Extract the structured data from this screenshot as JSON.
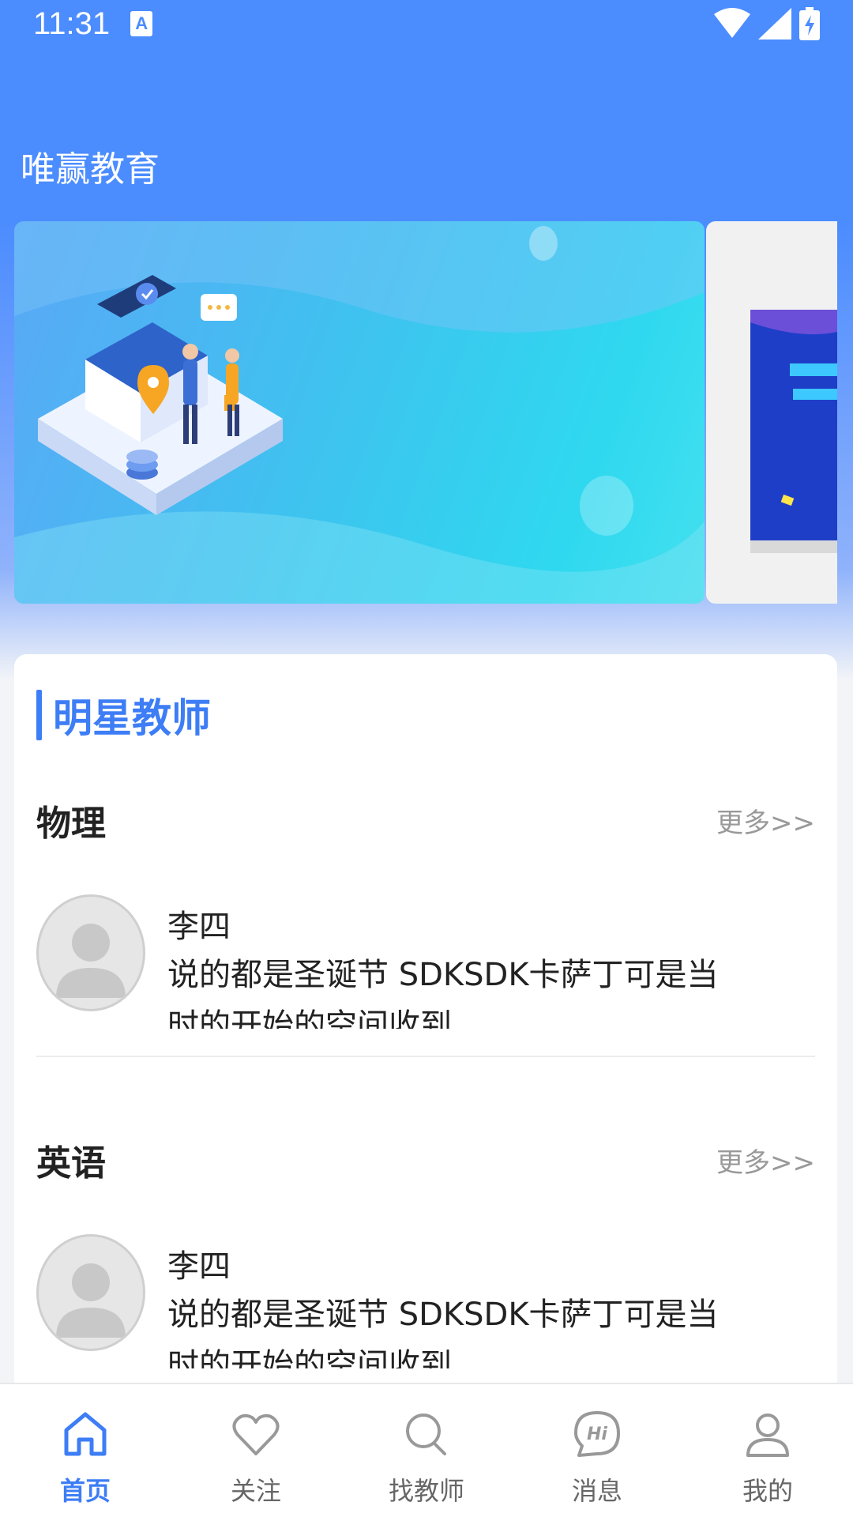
{
  "status_bar": {
    "time": "11:31",
    "notification_icon": "A"
  },
  "app": {
    "title": "唯赢教育"
  },
  "banner": {
    "main_icon": "store-illustration",
    "next_icon": "promo-card"
  },
  "section": {
    "title": "明星教师",
    "subjects": [
      {
        "name": "物理",
        "more": "更多>>",
        "teacher": {
          "name": "李四",
          "desc": "说的都是圣诞节 SDKSDK卡萨丁可是当时的开始的空间收到"
        }
      },
      {
        "name": "英语",
        "more": "更多>>",
        "teacher": {
          "name": "李四",
          "desc": "说的都是圣诞节 SDKSDK卡萨丁可是当时的开始的空间收到"
        }
      }
    ]
  },
  "nav": {
    "items": [
      {
        "label": "首页",
        "icon": "home-icon",
        "active": true
      },
      {
        "label": "关注",
        "icon": "heart-icon",
        "active": false
      },
      {
        "label": "找教师",
        "icon": "search-icon",
        "active": false
      },
      {
        "label": "消息",
        "icon": "hi-message-icon",
        "active": false
      },
      {
        "label": "我的",
        "icon": "user-icon",
        "active": false
      }
    ]
  },
  "colors": {
    "primary": "#4b8cff",
    "accent": "#3d7df5"
  }
}
